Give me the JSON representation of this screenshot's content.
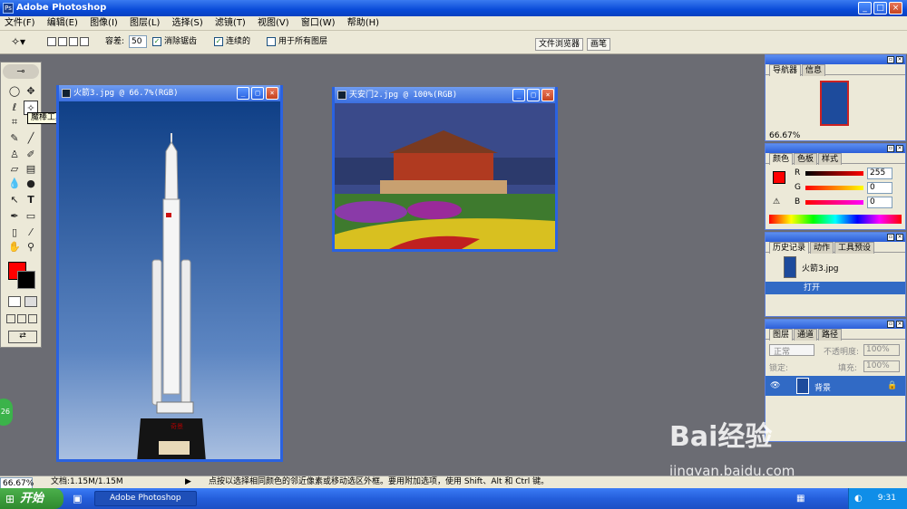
{
  "app": {
    "title": "Adobe Photoshop",
    "icon": "photoshop-icon"
  },
  "window_controls": {
    "minimize": "_",
    "maximize": "□",
    "close": "×"
  },
  "menu": [
    "文件(F)",
    "编辑(E)",
    "图像(I)",
    "图层(L)",
    "选择(S)",
    "滤镜(T)",
    "视图(V)",
    "窗口(W)",
    "帮助(H)"
  ],
  "options": {
    "tolerance_label": "容差:",
    "tolerance_value": "50",
    "anti_alias": "消除锯齿",
    "contiguous": "连续的",
    "all_layers": "用于所有图层",
    "file_browser": "文件浏览器",
    "brushes": "画笔"
  },
  "tooltip": "魔棒工具(W)",
  "doc1": {
    "title": "火箭3.jpg @ 66.7%(RGB)",
    "caption": "奇景"
  },
  "doc2": {
    "title": "天安门2.jpg @ 100%(RGB)"
  },
  "navigator": {
    "tabs": [
      "导航器",
      "信息"
    ],
    "zoom": "66.67%"
  },
  "color_panel": {
    "tabs": [
      "颜色",
      "色板",
      "样式"
    ],
    "r_label": "R",
    "g_label": "G",
    "b_label": "B",
    "r": "255",
    "g": "0",
    "b": "0"
  },
  "history": {
    "tabs": [
      "历史记录",
      "动作",
      "工具预设"
    ],
    "snapshot": "火箭3.jpg",
    "step": "打开"
  },
  "layers": {
    "tabs": [
      "图层",
      "通道",
      "路径"
    ],
    "mode": "正常",
    "opacity_label": "不透明度:",
    "opacity": "100%",
    "lock_label": "锁定:",
    "fill_label": "填充:",
    "fill": "100%",
    "layer_name": "背景"
  },
  "status": {
    "zoom": "66.67%",
    "doc": "文档:1.15M/1.15M",
    "hint": "点按以选择相同颜色的邻近像素或移动选区外框。要用附加选项，使用 Shift、Alt 和 Ctrl 键。"
  },
  "taskbar": {
    "start": "开始",
    "task": "Adobe Photoshop",
    "time": "9:31"
  },
  "side_badge": "26",
  "watermark": {
    "brand": "Bai经验",
    "url": "jingyan.baidu.com"
  },
  "colors": {
    "foreground": "#ff0000",
    "background": "#000000",
    "title_blue": "#0a4bd8"
  }
}
